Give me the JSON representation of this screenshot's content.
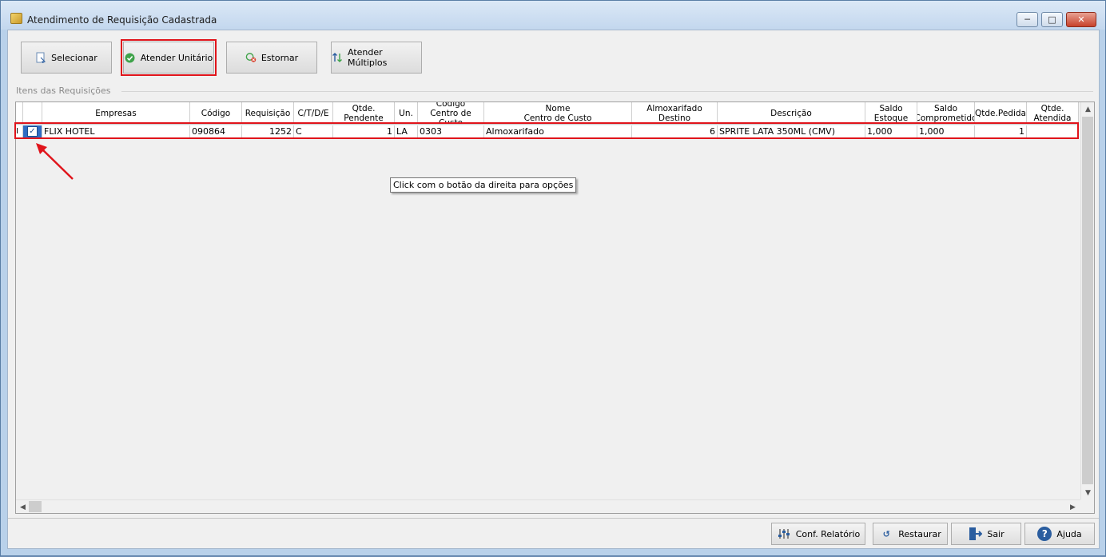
{
  "window": {
    "title": "Atendimento de Requisição Cadastrada"
  },
  "toolbar": {
    "selecionar": "Selecionar",
    "atender_unitario": "Atender Unitário",
    "estornar": "Estornar",
    "atender_multiplos": "Atender Múltiplos"
  },
  "group": {
    "label": "Itens das Requisições"
  },
  "grid": {
    "headers": {
      "empresas": "Empresas",
      "codigo": "Código",
      "requisicao": "Requisição",
      "ctde": "C/T/D/E",
      "qtde_pendente": "Qtde.\nPendente",
      "un": "Un.",
      "codigo_cc": "Código\nCentro de Custo",
      "nome_cc": "Nome\nCentro de Custo",
      "almox_destino": "Almoxarifado\nDestino",
      "descricao": "Descrição",
      "saldo_estoque": "Saldo\nEstoque",
      "saldo_comprometido": "Saldo\nComprometido",
      "qtde_pedida": "Qtde.Pedida",
      "qtde_atendida": "Qtde.\nAtendida"
    },
    "row": {
      "empresa": "FLIX HOTEL",
      "codigo": "090864",
      "requisicao": "1252",
      "ctde": "C",
      "qtde_pendente": "1",
      "un": "LA",
      "codigo_cc": "0303",
      "nome_cc": "Almoxarifado",
      "almox_destino": "6",
      "descricao": "SPRITE LATA 350ML (CMV)",
      "saldo_estoque": "1,000",
      "saldo_comprometido": "1,000",
      "qtde_pedida": "1",
      "qtde_atendida": "",
      "selected": true
    }
  },
  "tooltip": "Click com o botão da direita para opções",
  "bottom": {
    "conf_relatorio": "Conf. Relatório",
    "restaurar": "Restaurar",
    "sair": "Sair",
    "ajuda": "Ajuda"
  },
  "colors": {
    "highlight": "#e0141b",
    "accent": "#2a5d9f"
  }
}
